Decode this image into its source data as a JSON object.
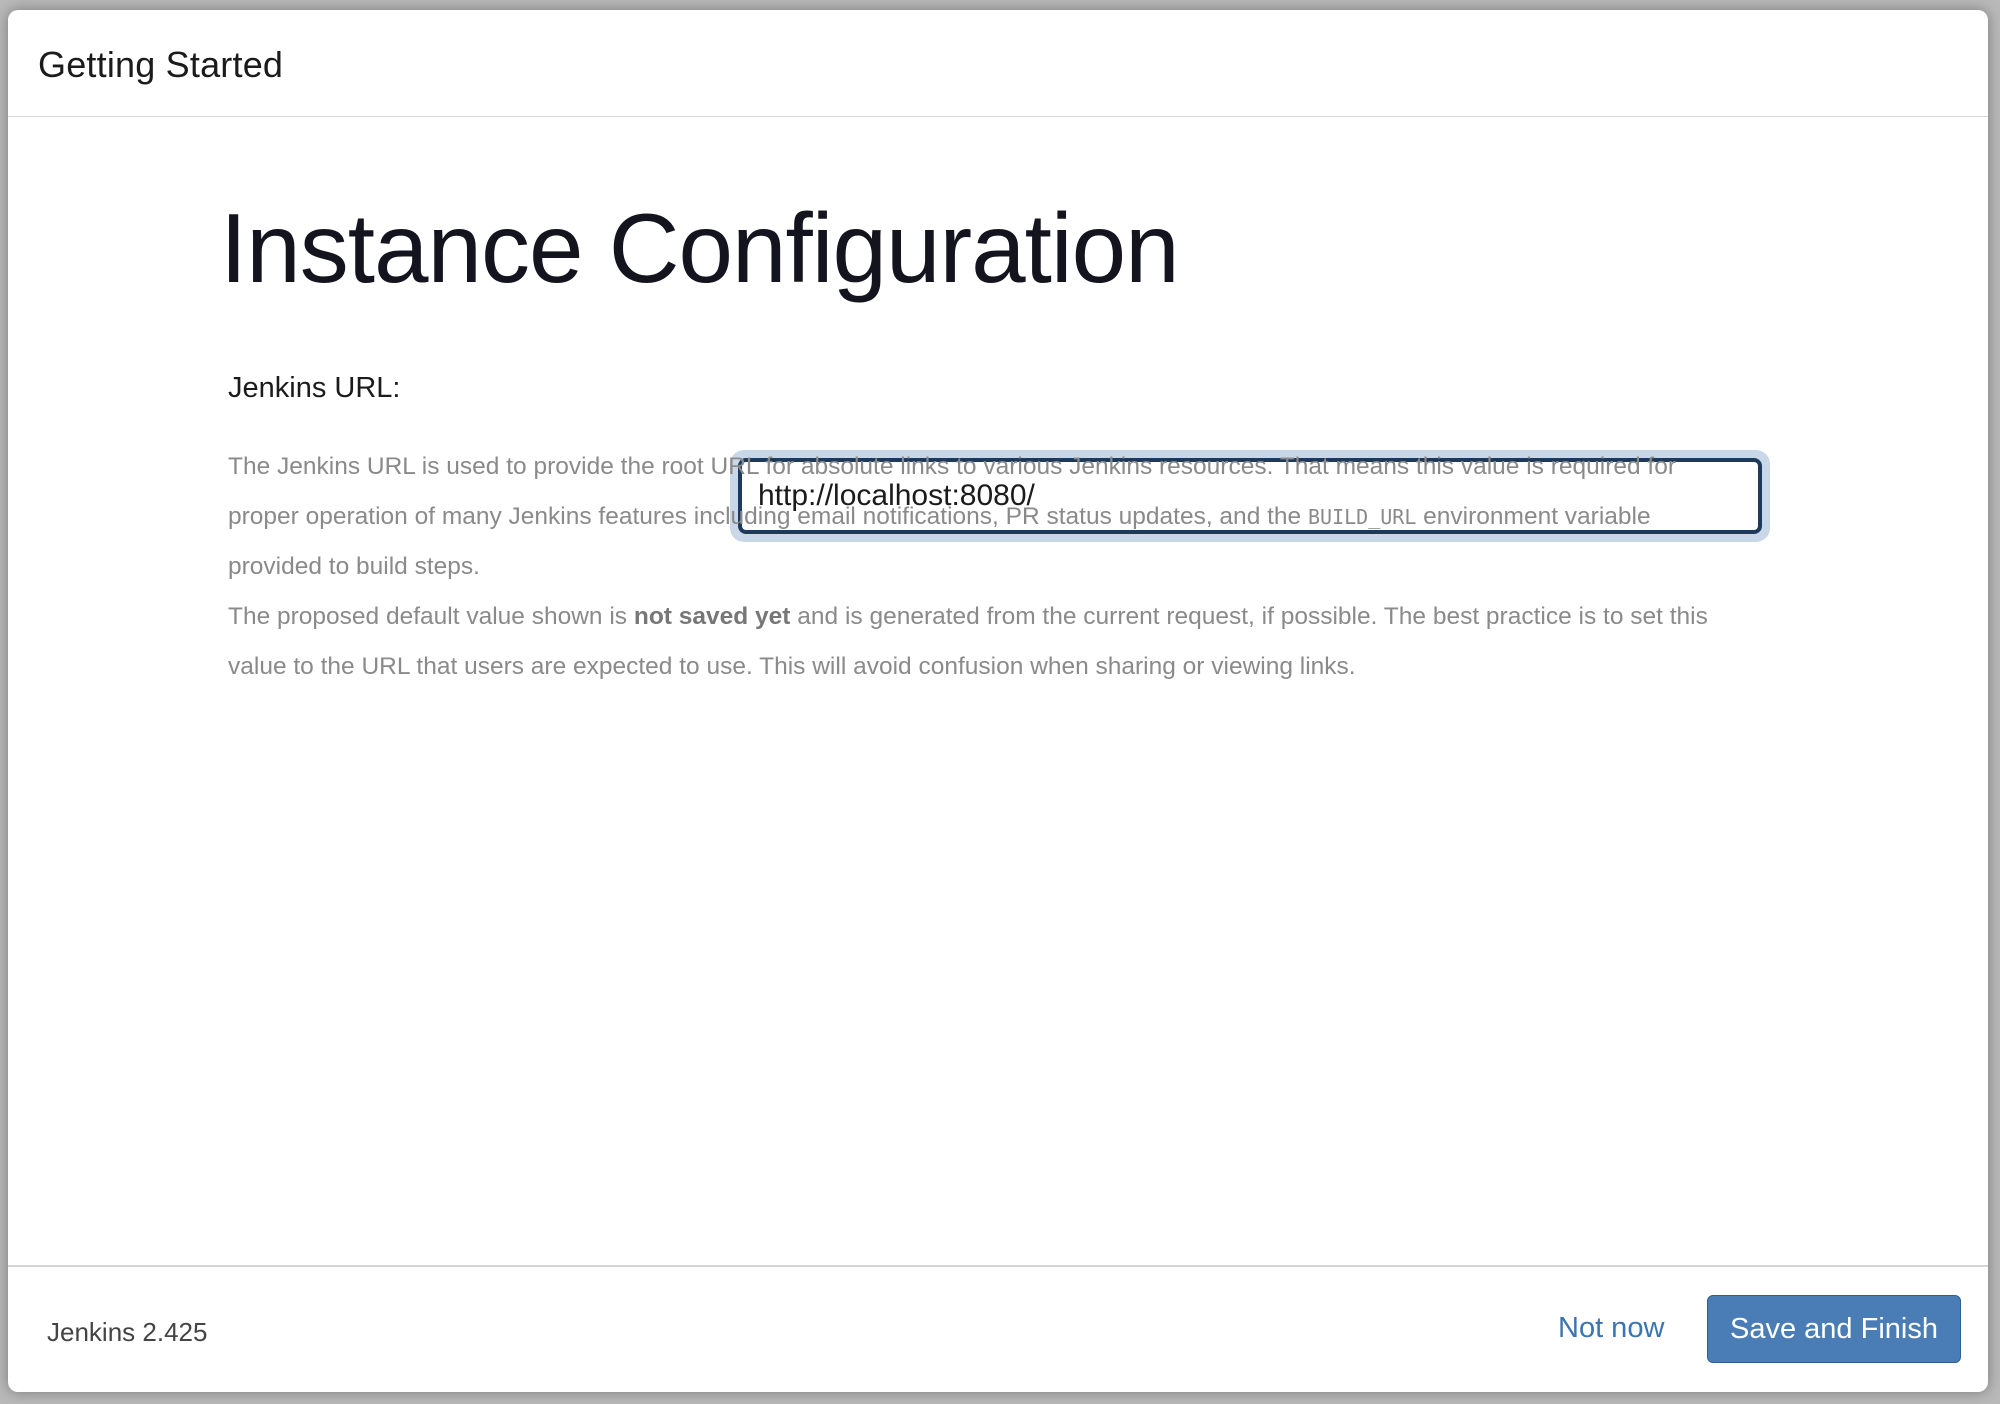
{
  "header": {
    "title": "Getting Started"
  },
  "main": {
    "page_title": "Instance Configuration",
    "url_label": "Jenkins URL:",
    "url_value": "http://localhost:8080/",
    "help": {
      "p1_part1": "The Jenkins URL is used to provide the root URL for absolute links to various Jenkins resources. That means this value is required for proper operation of many Jenkins features including email notifications, PR status updates, and the ",
      "p1_code": "BUILD_URL",
      "p1_part2": " environment variable provided to build steps.",
      "p2_part1": "The proposed default value shown is ",
      "p2_bold": "not saved yet",
      "p2_part2": " and is generated from the current request, if possible. The best practice is to set this value to the URL that users are expected to use. This will avoid confusion when sharing or viewing links."
    }
  },
  "footer": {
    "version": "Jenkins 2.425",
    "not_now_label": "Not now",
    "save_finish_label": "Save and Finish"
  },
  "colors": {
    "accent": "#4a7db6",
    "link": "#3a74b1",
    "input_border": "#1d3a5c",
    "focus_ring": "#c9d8e8"
  }
}
